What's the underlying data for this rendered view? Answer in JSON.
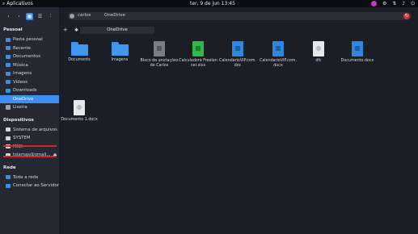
{
  "topbar": {
    "apps": "⌕ Aplicativos",
    "clock": "ter, 9 de jun   13:45"
  },
  "tray": {
    "battery": "▮"
  },
  "path": {
    "seg1": "carlos",
    "seg2": "OneDrive"
  },
  "tab": {
    "label": "OneDrive"
  },
  "sidebar": {
    "section_personal": "Pessoal",
    "section_devices": "Dispositivos",
    "section_network": "Rede",
    "personal": [
      "Pasta pessoal",
      "Recente",
      "Documentos",
      "Música",
      "Imagens",
      "Vídeos",
      "Downloads",
      "OneDrive",
      "Lixeira"
    ],
    "devices": [
      "Sistema de arquivos",
      "SYSTEM",
      "MKX",
      "tsjamas@gmail..."
    ],
    "network": [
      "Toda a rede",
      "Conectar ao Servidor"
    ]
  },
  "files": [
    {
      "label": "Documents",
      "kind": "folder"
    },
    {
      "label": "Imagens",
      "kind": "folder"
    },
    {
      "label": "Bloco de anotações de Carlos",
      "kind": "gray"
    },
    {
      "label": "Calculadora Freelancer.xlsx",
      "kind": "green"
    },
    {
      "label": "CalendarioVIP.com.doc",
      "kind": "blue"
    },
    {
      "label": "CalendarioVIP.com.docx",
      "kind": "blue"
    },
    {
      "label": "dfc",
      "kind": "white"
    },
    {
      "label": "Documento.docx",
      "kind": "blue"
    },
    {
      "label": "Documento 1.docx",
      "kind": "white"
    }
  ],
  "colors": {
    "accent": "#3e8ef3",
    "highlight_red": "#d5262c"
  }
}
